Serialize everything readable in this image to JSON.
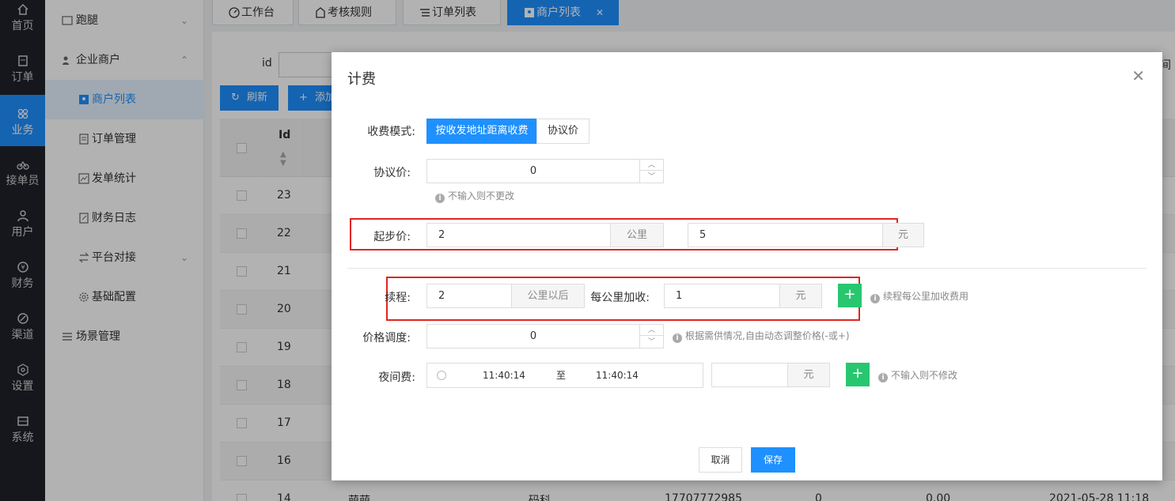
{
  "rail": [
    {
      "label": "首页",
      "icon": "home-icon"
    },
    {
      "label": "订单",
      "icon": "order-icon"
    },
    {
      "label": "业务",
      "icon": "business-icon",
      "active": true
    },
    {
      "label": "接单员",
      "icon": "bike-icon"
    },
    {
      "label": "用户",
      "icon": "user-icon"
    },
    {
      "label": "财务",
      "icon": "money-icon"
    },
    {
      "label": "渠道",
      "icon": "channel-icon"
    },
    {
      "label": "设置",
      "icon": "settings-icon"
    },
    {
      "label": "系统",
      "icon": "system-icon"
    }
  ],
  "menu": {
    "paotui": "跑腿",
    "enterprise": "企业商户",
    "merchant_list": "商户列表",
    "order_manage": "订单管理",
    "dispatch_stats": "发单统计",
    "finance_log": "财务日志",
    "platform": "平台对接",
    "base_config": "基础配置",
    "scene_manage": "场景管理"
  },
  "tabs": [
    "工作台",
    "考核规则",
    "订单列表",
    "商户列表"
  ],
  "background": {
    "id_label": "id",
    "time_label": "间",
    "refresh_btn": "刷新",
    "add_btn": "添加",
    "col_id": "Id",
    "row_ids": [
      "23",
      "22",
      "21",
      "20",
      "19",
      "18",
      "17",
      "16",
      "14"
    ],
    "last_row": {
      "name": "萌萌",
      "type": "码科",
      "phone": "17707772985",
      "count": "0",
      "amount": "0.00",
      "time": "2021-05-28 11:18"
    }
  },
  "modal": {
    "title": "计费",
    "mode_label": "收费模式:",
    "mode_options": [
      "按收发地址距离收费",
      "协议价"
    ],
    "agreement_label": "协议价:",
    "agreement_value": "0",
    "agreement_hint": "不输入则不更改",
    "start_label": "起步价:",
    "start_km": "2",
    "start_km_unit": "公里",
    "start_price": "5",
    "start_price_unit": "元",
    "cont_label": "续程:",
    "cont_km": "2",
    "cont_km_unit": "公里以后",
    "per_km_label": "每公里加收:",
    "per_km_value": "1",
    "per_km_unit": "元",
    "cont_hint": "续程每公里加收费用",
    "adjust_label": "价格调度:",
    "adjust_value": "0",
    "adjust_hint": "根据需供情况,自由动态调整价格(-或+)",
    "night_label": "夜间费:",
    "night_start": "11:40:14",
    "night_sep": "至",
    "night_end": "11:40:14",
    "night_unit": "元",
    "night_hint": "不输入则不修改",
    "cancel": "取消",
    "save": "保存"
  }
}
